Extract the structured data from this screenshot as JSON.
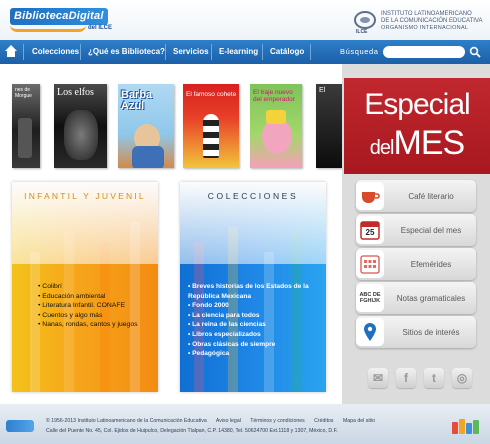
{
  "header": {
    "logo_text": "BibliotecaDigital",
    "logo_sub": "del ILCE",
    "ilce_line1": "INSTITUTO LATINOAMERICANO",
    "ilce_line2": "DE LA COMUNICACIÓN EDUCATIVA",
    "ilce_org": "ORGANISMO INTERNACIONAL",
    "ilce_label": "ILCE"
  },
  "nav": {
    "home_icon": "home-icon",
    "items": [
      "Colecciones",
      "¿Qué es Biblioteca?",
      "Servicios",
      "E-learning",
      "Catálogo"
    ],
    "search_label": "Búsqueda",
    "search_value": "",
    "search_icon": "search-icon"
  },
  "carousel": {
    "books": [
      {
        "title": "nes de Morgue",
        "cover_color": "#1e1e1e"
      },
      {
        "title": "Los elfos",
        "cover_color": "#101010"
      },
      {
        "title": "Barba Azul",
        "cover_color": "#8fc7ea"
      },
      {
        "title": "El famoso cohete",
        "cover_color": "#e84028"
      },
      {
        "title": "El traje nuevo del emperador",
        "cover_color": "#a3d76a"
      },
      {
        "title": "El",
        "cover_color": "#0c0c0c"
      }
    ]
  },
  "infantil": {
    "title": "INFANTIL Y JUVENIL",
    "items": [
      "Colibrí",
      "Educación ambiental",
      "Literatura Infantil. CONAFE",
      "Cuentos y algo más",
      "Nanas, rondas, cantos y juegos"
    ]
  },
  "colecciones": {
    "title": "COLECCIONES",
    "items": [
      "Breves historias de los Estados de la República Mexicana",
      "Fondo 2000",
      "La ciencia para todos",
      "La reina de las ciencias",
      "Libros especializados",
      "Obras clásicas de siempre",
      "Pedagógica"
    ]
  },
  "sidebar": {
    "especial_line1": "Especial",
    "especial_del": "del",
    "especial_mes": "MES",
    "buttons": [
      {
        "label": "Café literario",
        "icon": "coffee-cup-icon"
      },
      {
        "label": "Especial del mes",
        "icon": "calendar-icon",
        "icon_text": "25"
      },
      {
        "label": "Efemérides",
        "icon": "calendar-grid-icon"
      },
      {
        "label": "Notas gramaticales",
        "icon": "abc-letters-icon",
        "icon_text": "ABC DE FGHIJK"
      },
      {
        "label": "Sitios de interés",
        "icon": "map-pin-icon"
      }
    ],
    "social": [
      {
        "icon": "email-icon",
        "glyph": "✉"
      },
      {
        "icon": "facebook-icon",
        "glyph": "f"
      },
      {
        "icon": "twitter-icon",
        "glyph": "t"
      },
      {
        "icon": "instagram-icon",
        "glyph": "◎"
      }
    ]
  },
  "footer": {
    "copyright": "© 1956-2013 Instituto Latinoamericano de la Comunicación Educativa",
    "links": [
      "Aviso legal",
      "Términos y condiciones",
      "Créditos",
      "Mapa del sitio"
    ],
    "address": "Calle del Puente No. 45, Col. Ejidos de Huipulco, Delegación Tlalpan, C.P. 14380, Tel. 50624700 Ext.1118 y 1307, México, D.F."
  },
  "colors": {
    "nav_blue": "#1b5fa8",
    "especial_red": "#b01f26",
    "infantil_orange": "#f6a51b",
    "colecciones_blue": "#1f86e6"
  }
}
